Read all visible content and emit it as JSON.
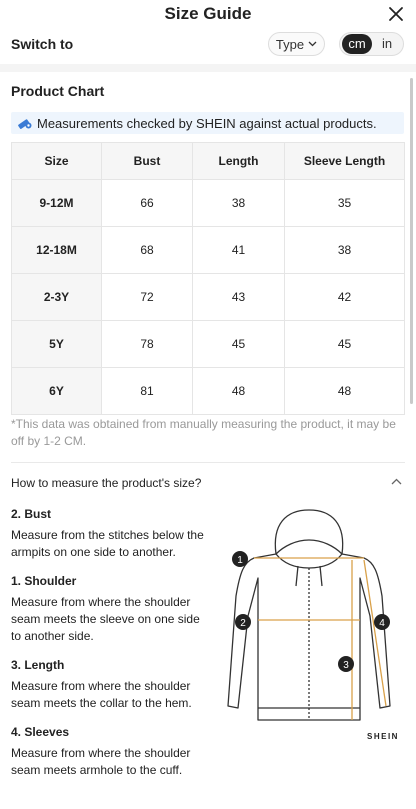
{
  "header": {
    "title": "Size Guide"
  },
  "switch": {
    "label": "Switch to",
    "type_label": "Type",
    "unit_selected": "cm",
    "unit_other": "in"
  },
  "product_chart": {
    "title": "Product Chart",
    "notice": "Measurements checked by SHEIN against actual products.",
    "columns": [
      "Size",
      "Bust",
      "Length",
      "Sleeve Length"
    ],
    "rows": [
      [
        "9-12M",
        "66",
        "38",
        "35"
      ],
      [
        "12-18M",
        "68",
        "41",
        "38"
      ],
      [
        "2-3Y",
        "72",
        "43",
        "42"
      ],
      [
        "5Y",
        "78",
        "45",
        "45"
      ],
      [
        "6Y",
        "81",
        "48",
        "48"
      ]
    ],
    "footnote": "*This data was obtained from manually measuring the product, it may be off by 1-2 CM."
  },
  "howto": {
    "title": "How to measure the product's size?",
    "steps": [
      {
        "title": "2. Bust",
        "text": "Measure from the stitches below the armpits on one side to another."
      },
      {
        "title": "1. Shoulder",
        "text": "Measure from where the shoulder seam meets the sleeve on one side to another side."
      },
      {
        "title": "3. Length",
        "text": "Measure from where the shoulder seam meets the collar to the hem."
      },
      {
        "title": "4. Sleeves",
        "text": "Measure from where the shoulder seam meets armhole to the cuff."
      }
    ],
    "markers": [
      "1",
      "2",
      "3",
      "4"
    ],
    "brand": "SHEIN"
  },
  "colors": {
    "accent_line": "#d9a14a",
    "notice_bg": "#eef5fd"
  }
}
